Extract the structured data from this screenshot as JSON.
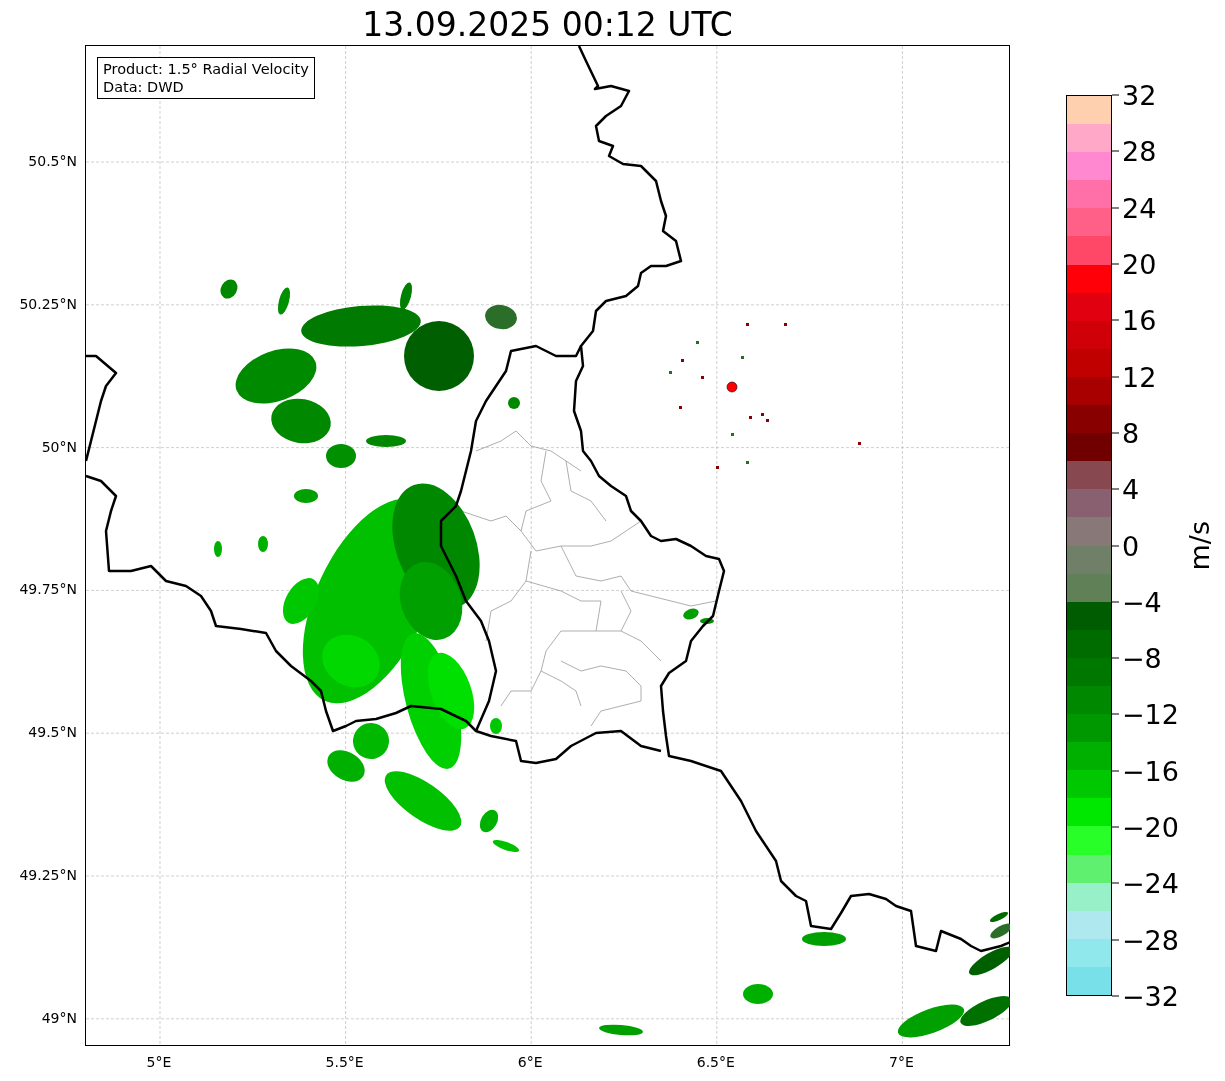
{
  "title": "13.09.2025 00:12 UTC",
  "info_box": {
    "lines": [
      "Product: 1.5° Radial Velocity",
      "Data: DWD"
    ]
  },
  "y_ticks": [
    "50.5°N",
    "50.25°N",
    "50°N",
    "49.75°N",
    "49.5°N",
    "49.25°N",
    "49°N"
  ],
  "x_ticks": [
    "5°E",
    "5.5°E",
    "6°E",
    "6.5°E",
    "7°E"
  ],
  "colorbar": {
    "label": "m/s",
    "ticks": [
      "32",
      "28",
      "24",
      "20",
      "16",
      "12",
      "8",
      "4",
      "0",
      "−4",
      "−8",
      "−12",
      "−16",
      "−20",
      "−24",
      "−28",
      "−32"
    ],
    "bands": [
      {
        "color": "#ffd0b0"
      },
      {
        "color": "#ffa8c8"
      },
      {
        "color": "#ff88d0"
      },
      {
        "color": "#ff70a8"
      },
      {
        "color": "#ff6088"
      },
      {
        "color": "#ff4868"
      },
      {
        "color": "#ff0008"
      },
      {
        "color": "#e00010"
      },
      {
        "color": "#d00008"
      },
      {
        "color": "#c00000"
      },
      {
        "color": "#a80000"
      },
      {
        "color": "#880000"
      },
      {
        "color": "#700000"
      },
      {
        "color": "#884850"
      },
      {
        "color": "#886070"
      },
      {
        "color": "#887878"
      },
      {
        "color": "#708068"
      },
      {
        "color": "#608058"
      },
      {
        "color": "#005c00"
      },
      {
        "color": "#006c00"
      },
      {
        "color": "#007800"
      },
      {
        "color": "#008800"
      },
      {
        "color": "#009800"
      },
      {
        "color": "#00b000"
      },
      {
        "color": "#00c800"
      },
      {
        "color": "#00e800"
      },
      {
        "color": "#28ff28"
      },
      {
        "color": "#60f070"
      },
      {
        "color": "#98f0c8"
      },
      {
        "color": "#b0e8f0"
      },
      {
        "color": "#90e8ec"
      },
      {
        "color": "#78e0e8"
      }
    ]
  }
}
